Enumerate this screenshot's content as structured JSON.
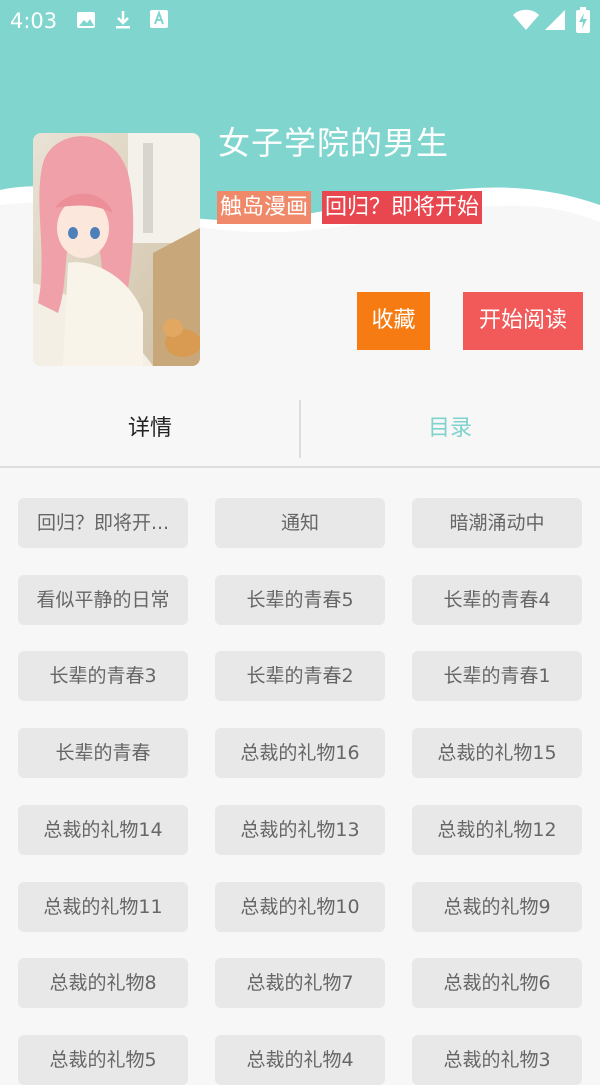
{
  "status_bar": {
    "time": "4:03"
  },
  "comic": {
    "title": "女子学院的男生",
    "source_tag": "触岛漫画",
    "status_tag": "回归？即将开始"
  },
  "actions": {
    "favorite": "收藏",
    "start_reading": "开始阅读"
  },
  "tabs": {
    "detail": "详情",
    "catalog": "目录",
    "active": "目录"
  },
  "colors": {
    "header": "#80d6cf",
    "source_tag": "#f0896a",
    "status_tag": "#e8474f",
    "favorite_button": "#f57b12",
    "read_button": "#f25a5a",
    "active_tab": "#7fd3cc"
  },
  "chapters": [
    "回归？即将开...",
    "通知",
    "暗潮涌动中",
    "看似平静的日常",
    "长辈的青春5",
    "长辈的青春4",
    "长辈的青春3",
    "长辈的青春2",
    "长辈的青春1",
    "长辈的青春",
    "总裁的礼物16",
    "总裁的礼物15",
    "总裁的礼物14",
    "总裁的礼物13",
    "总裁的礼物12",
    "总裁的礼物11",
    "总裁的礼物10",
    "总裁的礼物9",
    "总裁的礼物8",
    "总裁的礼物7",
    "总裁的礼物6",
    "总裁的礼物5",
    "总裁的礼物4",
    "总裁的礼物3"
  ]
}
